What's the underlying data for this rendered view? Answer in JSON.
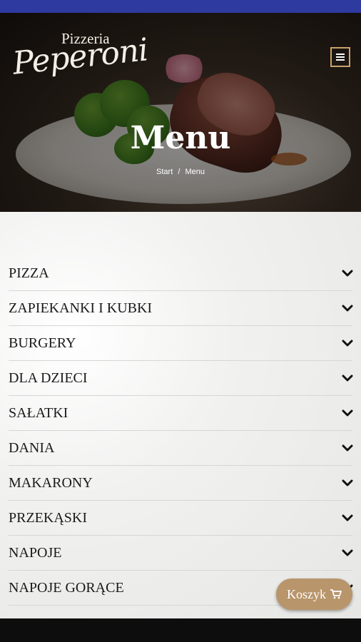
{
  "brand": {
    "line1": "Pizzeria",
    "line2": "Peperoni"
  },
  "hero": {
    "title": "Menu"
  },
  "breadcrumb": {
    "home": "Start",
    "separator": "/",
    "current": "Menu"
  },
  "menu": {
    "categories": [
      {
        "label": "PIZZA"
      },
      {
        "label": "ZAPIEKANKI I KUBKI"
      },
      {
        "label": "BURGERY"
      },
      {
        "label": "DLA DZIECI"
      },
      {
        "label": "SAŁATKI"
      },
      {
        "label": "DANIA"
      },
      {
        "label": "MAKARONY"
      },
      {
        "label": "PRZEKĄSKI"
      },
      {
        "label": "NAPOJE"
      },
      {
        "label": "NAPOJE GORĄCE"
      }
    ]
  },
  "cart": {
    "label": "Koszyk",
    "icon": "cart-icon"
  },
  "nav": {
    "icon": "hamburger-icon"
  },
  "colors": {
    "statusbar": "#2e3a9f",
    "accent": "#b8956b",
    "menu_border": "#c9a26b"
  }
}
